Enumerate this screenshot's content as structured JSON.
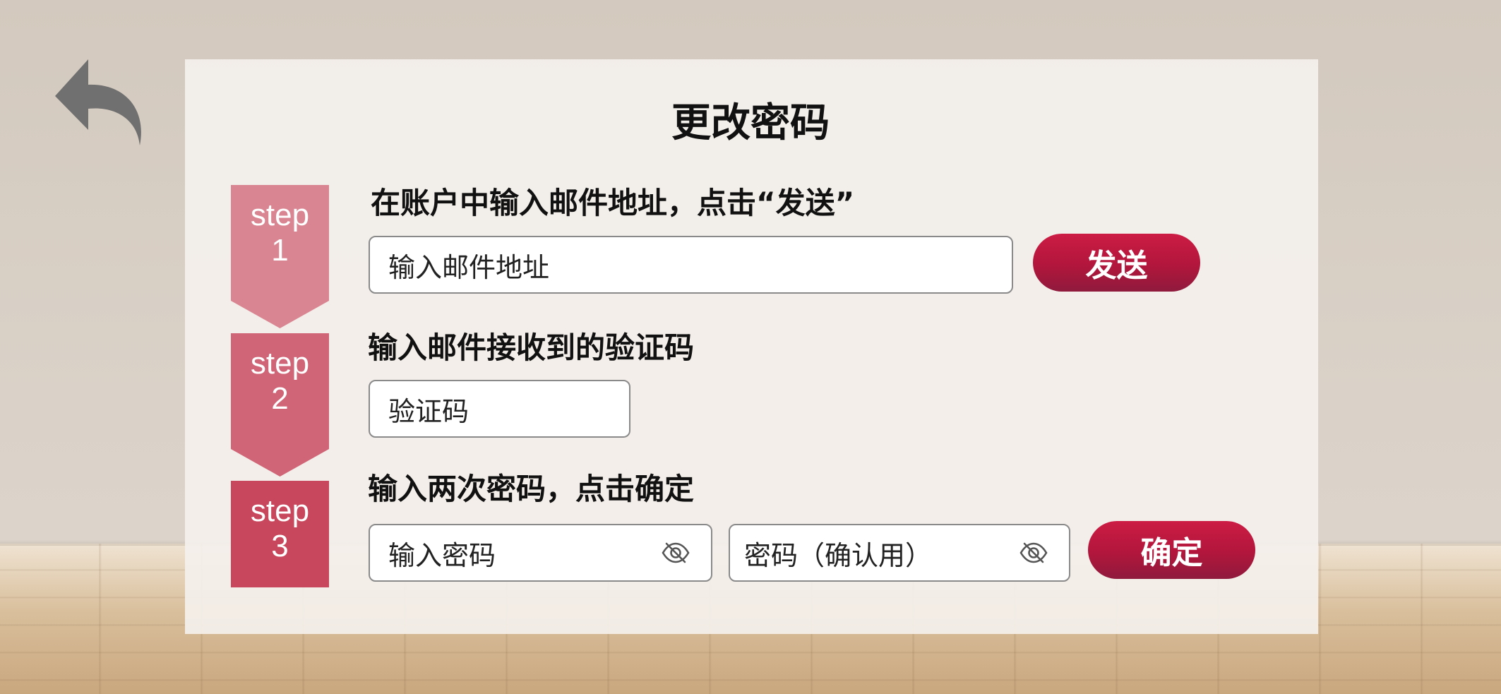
{
  "screen": {
    "title": "更改密码"
  },
  "steps": [
    {
      "word": "step",
      "num": "1",
      "color": "#d98592",
      "instruction": "在账户中输入邮件地址，点击“发送”",
      "email_placeholder": "输入邮件地址",
      "send_label": "发送"
    },
    {
      "word": "step",
      "num": "2",
      "color": "#cf6577",
      "instruction": "输入邮件接收到的验证码",
      "code_placeholder": "验证码"
    },
    {
      "word": "step",
      "num": "3",
      "color": "#c8475c",
      "instruction": "输入两次密码，点击确定",
      "password_placeholder": "输入密码",
      "confirm_placeholder": "密码（确认用）",
      "confirm_label": "确定"
    }
  ],
  "icons": {
    "back": "back-arrow-icon",
    "visibility": "eye-off-icon"
  },
  "colors": {
    "accent": "#c21a42",
    "back_icon": "#707070"
  }
}
